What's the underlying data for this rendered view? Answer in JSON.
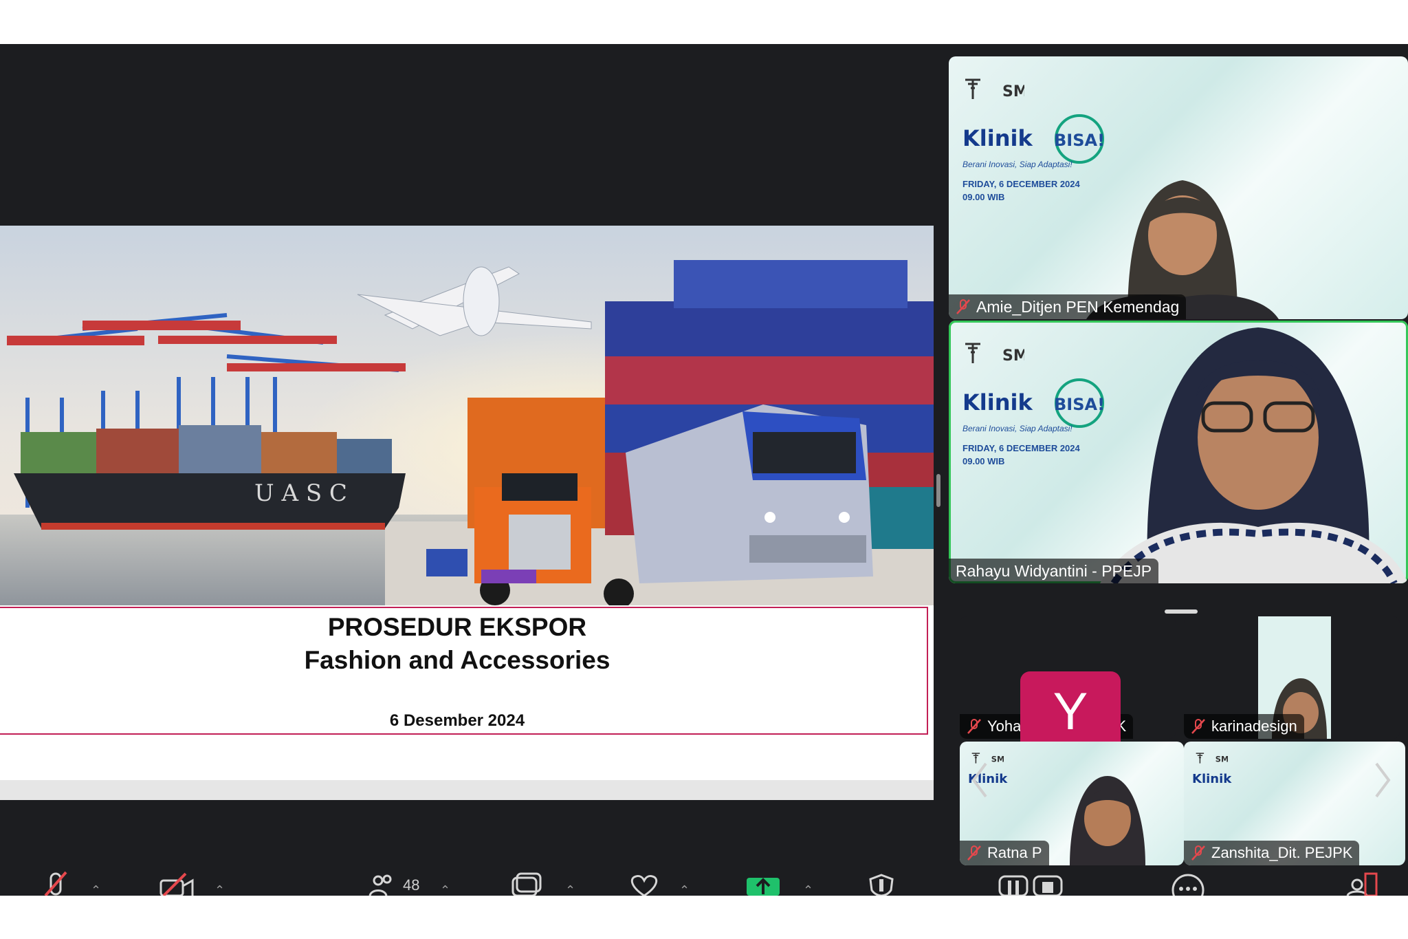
{
  "slide": {
    "title_line1": "PROSEDUR EKSPOR",
    "title_line2": "Fashion and Accessories",
    "date": "6 Desember 2024",
    "ship_lettering": "U A S C"
  },
  "event_backdrop": {
    "klinik": "Klinik",
    "brand": "BISA!",
    "tagline": "Berani Inovasi, Siap Adaptasi!",
    "date_line": "FRIDAY, 6 DECEMBER 2024",
    "time_line": "09.00 WIB"
  },
  "participants": {
    "tile1_name": "Amie_Ditjen PEN Kemendag",
    "tile2_name": "Rahayu Widyantini - PPEJP",
    "tile3_name": "Yohana - Dit. PEJPK",
    "tile3_avatar": "Y",
    "tile4_name": "karinadesign",
    "tile5_name": "Ratna P",
    "tile6_name": "Zanshita_Dit. PEJPK"
  },
  "toolbar": {
    "participants_count": "48"
  },
  "colors": {
    "app_bg": "#1c1d20",
    "speaker_outline": "#34c759",
    "avatar_bg": "#c8195c",
    "share_green": "#1fc16b",
    "mute_red": "#e5484d"
  }
}
